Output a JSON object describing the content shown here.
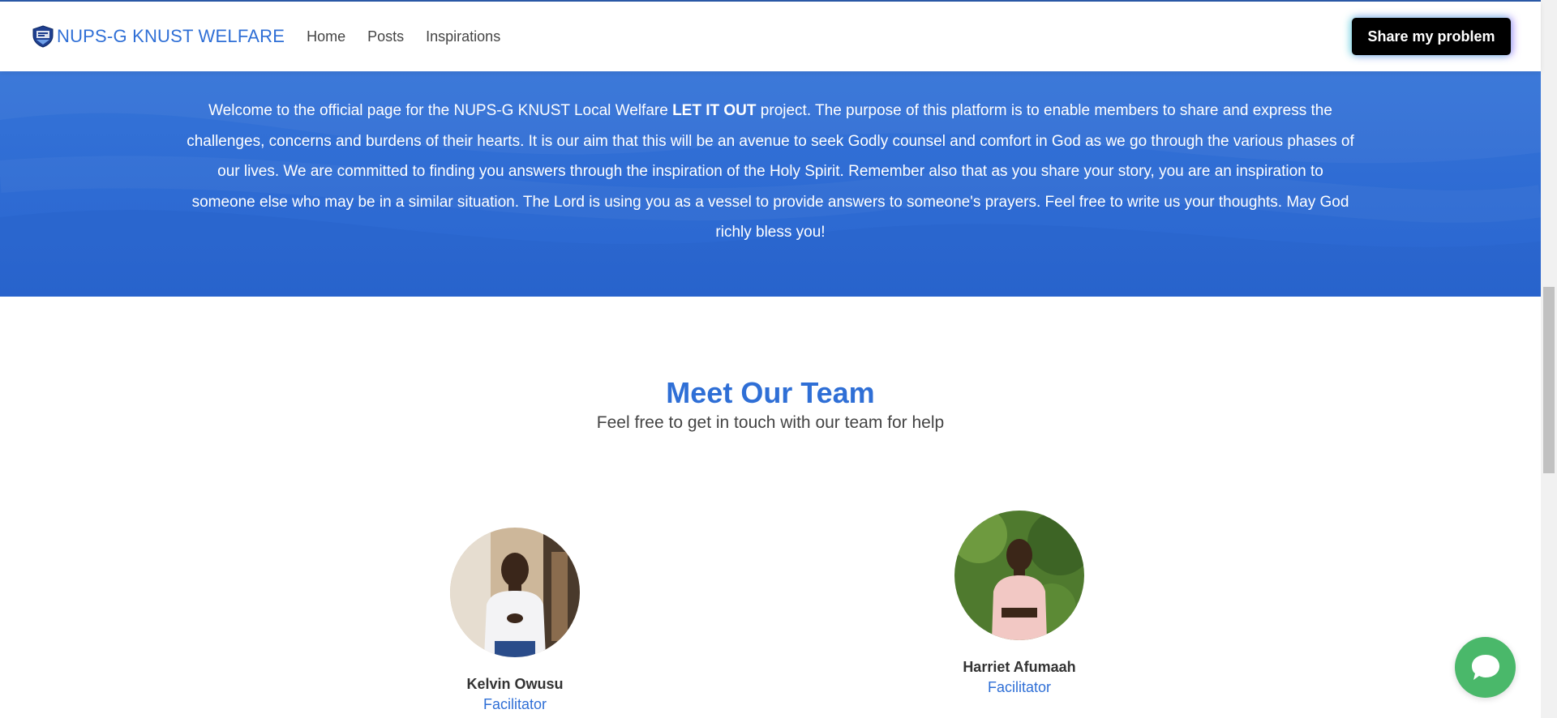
{
  "nav": {
    "brand": "NUPS-G KNUST WELFARE",
    "links": [
      "Home",
      "Posts",
      "Inspirations"
    ],
    "cta": "Share my problem"
  },
  "hero": {
    "text_before": "Welcome to the official page for the NUPS-G KNUST Local Welfare ",
    "text_bold": "LET IT OUT",
    "text_after": " project. The purpose of this platform is to enable members to share and express the challenges, concerns and burdens of their hearts. It is our aim that this will be an avenue to seek Godly counsel and comfort in God as we go through the various phases of our lives. We are committed to finding you answers through the inspiration of the Holy Spirit. Remember also that as you share your story, you are an inspiration to someone else who may be in a similar situation. The Lord is using you as a vessel to provide answers to someone's prayers. Feel free to write us your thoughts. May God richly bless you!"
  },
  "team": {
    "title": "Meet Our Team",
    "subtitle": "Feel free to get in touch with our team for help",
    "members": [
      {
        "name": "Kelvin Owusu",
        "role": "Facilitator"
      },
      {
        "name": "Harriet Afumaah",
        "role": "Facilitator"
      }
    ]
  },
  "colors": {
    "brand": "#2f6fd6",
    "hero_bg": "#2e6bd3",
    "cta_bg": "#000000",
    "chat": "#4ab86a"
  },
  "icons": [
    "shield-logo-icon",
    "chat-bubble-icon"
  ]
}
